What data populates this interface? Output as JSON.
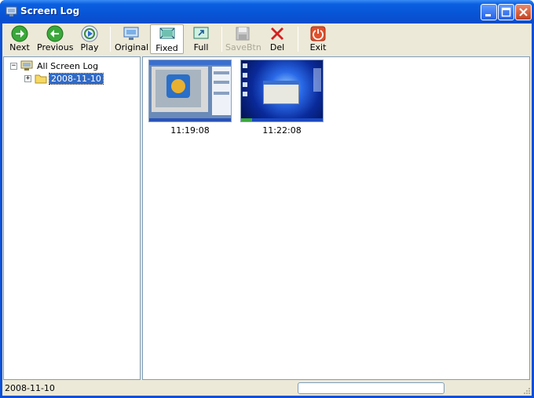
{
  "window": {
    "title": "Screen Log"
  },
  "toolbar": {
    "next": "Next",
    "previous": "Previous",
    "play": "Play",
    "original": "Original",
    "fixed": "Fixed",
    "full": "Full",
    "save": "SaveBtn",
    "del": "Del",
    "exit": "Exit"
  },
  "tree": {
    "root": "All Screen Log",
    "child": "2008-11-10"
  },
  "thumbnails": [
    {
      "time": "11:19:08"
    },
    {
      "time": "11:22:08"
    }
  ],
  "status": {
    "text": "2008-11-10"
  },
  "colors": {
    "title_bar": "#0a5fe0",
    "selection": "#316ac5",
    "face": "#ece9d8"
  }
}
